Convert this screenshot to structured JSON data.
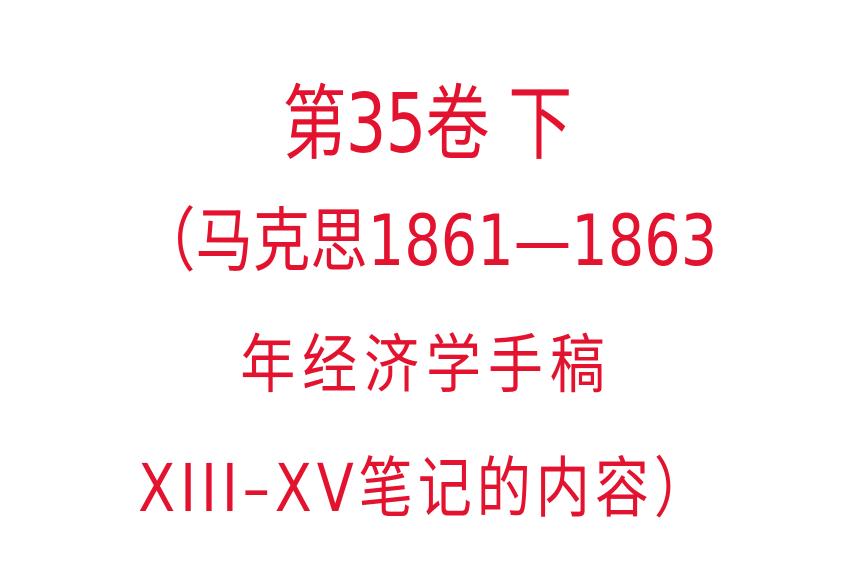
{
  "title": {
    "line1": "第35卷 下",
    "line2": "（马克思1861—1863",
    "line3": "年经济学手稿",
    "line4": "XIII–XV笔记的内容）"
  },
  "colors": {
    "text": "#e3132f",
    "background": "#ffffff"
  }
}
